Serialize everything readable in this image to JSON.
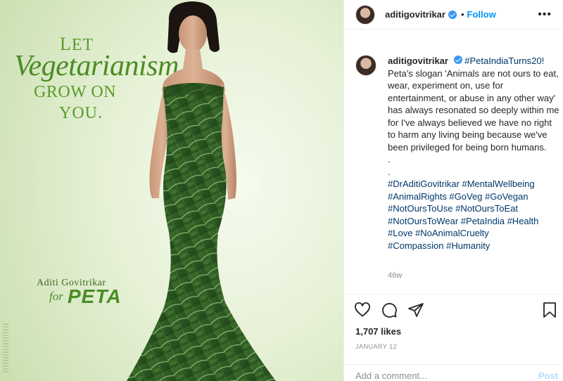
{
  "poster": {
    "let_cap": "L",
    "let_rest": "ET",
    "word": "Vegetarianism",
    "grow_line": "GROW ON",
    "you_line": "YOU.",
    "credit_name": "Aditi Govitrikar",
    "credit_for": "for",
    "credit_org": "PETA"
  },
  "header": {
    "username": "aditigovitrikar",
    "separator": "•",
    "follow_label": "Follow",
    "more_icon": "ellipsis-icon"
  },
  "caption": {
    "username": "aditigovitrikar",
    "first_tag": "#PetaIndiaTurns20!",
    "text": "Peta's slogan 'Animals are not ours to eat, wear, experiment on, use for entertainment, or abuse in any other way' has always resonated so deeply within me for I've always believed we have no right to harm any living being because we've been privileged for being born humans.",
    "dot1": ".",
    "dot2": ".",
    "hashtags_line1": "#DrAditiGovitrikar #MentalWellbeing",
    "hashtags_line2": "#AnimalRights #GoVeg #GoVegan",
    "hashtags_line3": "#NotOursToUse #NotOursToEat",
    "hashtags_line4": "#NotOursToWear #PetaIndia #Health",
    "hashtags_line5": "#Love #NoAnimalCruelty",
    "hashtags_line6": "#Compassion #Humanity",
    "age": "46w"
  },
  "actions": {
    "like_icon": "heart-icon",
    "comment_icon": "comment-icon",
    "share_icon": "share-icon",
    "save_icon": "bookmark-icon",
    "likes": "1,707 likes",
    "date": "January 12"
  },
  "comment_box": {
    "placeholder": "Add a comment...",
    "post_label": "Post",
    "post_color": "#b2dffc"
  },
  "colors": {
    "link": "#00376b",
    "follow": "#0095f6",
    "verified": "#3897f0",
    "poster_green": "#4b8d24"
  }
}
